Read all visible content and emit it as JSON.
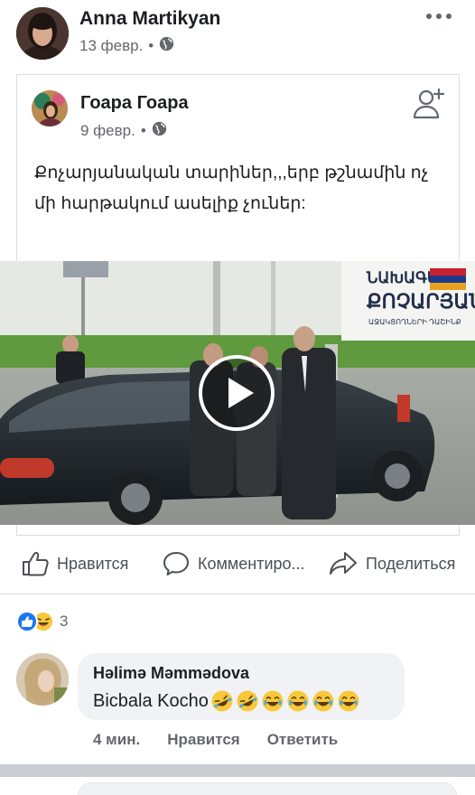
{
  "post": {
    "author": "Anna Martikyan",
    "date": "13 февр.",
    "separator": "•",
    "privacy_icon": "globe-icon",
    "more_icon": "more-dots-icon"
  },
  "shared_post": {
    "author": "Гоара Гоара",
    "date": "9 февр.",
    "separator": "•",
    "privacy_icon": "globe-icon",
    "add_friend_icon": "add-friend-icon",
    "text": "Քոչարյանական տարիներ,,,երբ թշնամին ոչ մի  հարթակում ասելիք չուներ:"
  },
  "video": {
    "sign_line1": "ՆԱԽԱԳԱՀ",
    "sign_line2": "ՔՈՉԱՐՅԱՆԻ",
    "sign_line3": "ԱՋԱԿՑՈՂՆԵՐԻ ԴԱՇԻՆՔ",
    "play_icon": "play-icon"
  },
  "actions": {
    "like": "Нравится",
    "comment": "Комментиро...",
    "share": "Поделиться"
  },
  "reactions": {
    "count": "3",
    "colors": {
      "like": "#1877f2",
      "laugh": "#f7c93a"
    }
  },
  "comment": {
    "author": "Həlimə Məmmədova",
    "text": "Bicbala Kocho",
    "emojis": [
      "rofl-emoji",
      "rofl-emoji",
      "joy-emoji",
      "joy-emoji",
      "joy-emoji",
      "joy-emoji"
    ],
    "time": "4 мин.",
    "like": "Нравится",
    "reply": "Ответить"
  }
}
